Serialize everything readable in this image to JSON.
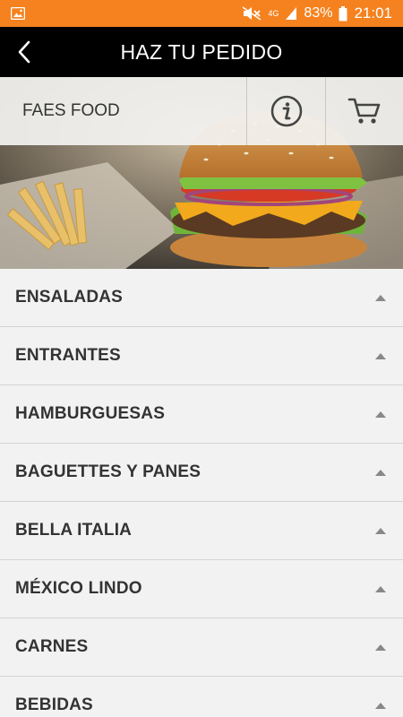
{
  "status_bar": {
    "battery": "83%",
    "time": "21:01",
    "network": "4G"
  },
  "header": {
    "title": "HAZ TU PEDIDO"
  },
  "store": {
    "name": "FAES FOOD"
  },
  "icons": {
    "back": "back-arrow-icon",
    "info": "info-icon",
    "cart": "cart-icon",
    "caret": "caret-up-icon"
  },
  "colors": {
    "status_bar": "#f5821f",
    "header": "#000000"
  },
  "categories": [
    {
      "label": "ENSALADAS"
    },
    {
      "label": "ENTRANTES"
    },
    {
      "label": "HAMBURGUESAS"
    },
    {
      "label": "BAGUETTES Y PANES"
    },
    {
      "label": "BELLA ITALIA"
    },
    {
      "label": "MÉXICO LINDO"
    },
    {
      "label": "CARNES"
    },
    {
      "label": "BEBIDAS"
    }
  ]
}
